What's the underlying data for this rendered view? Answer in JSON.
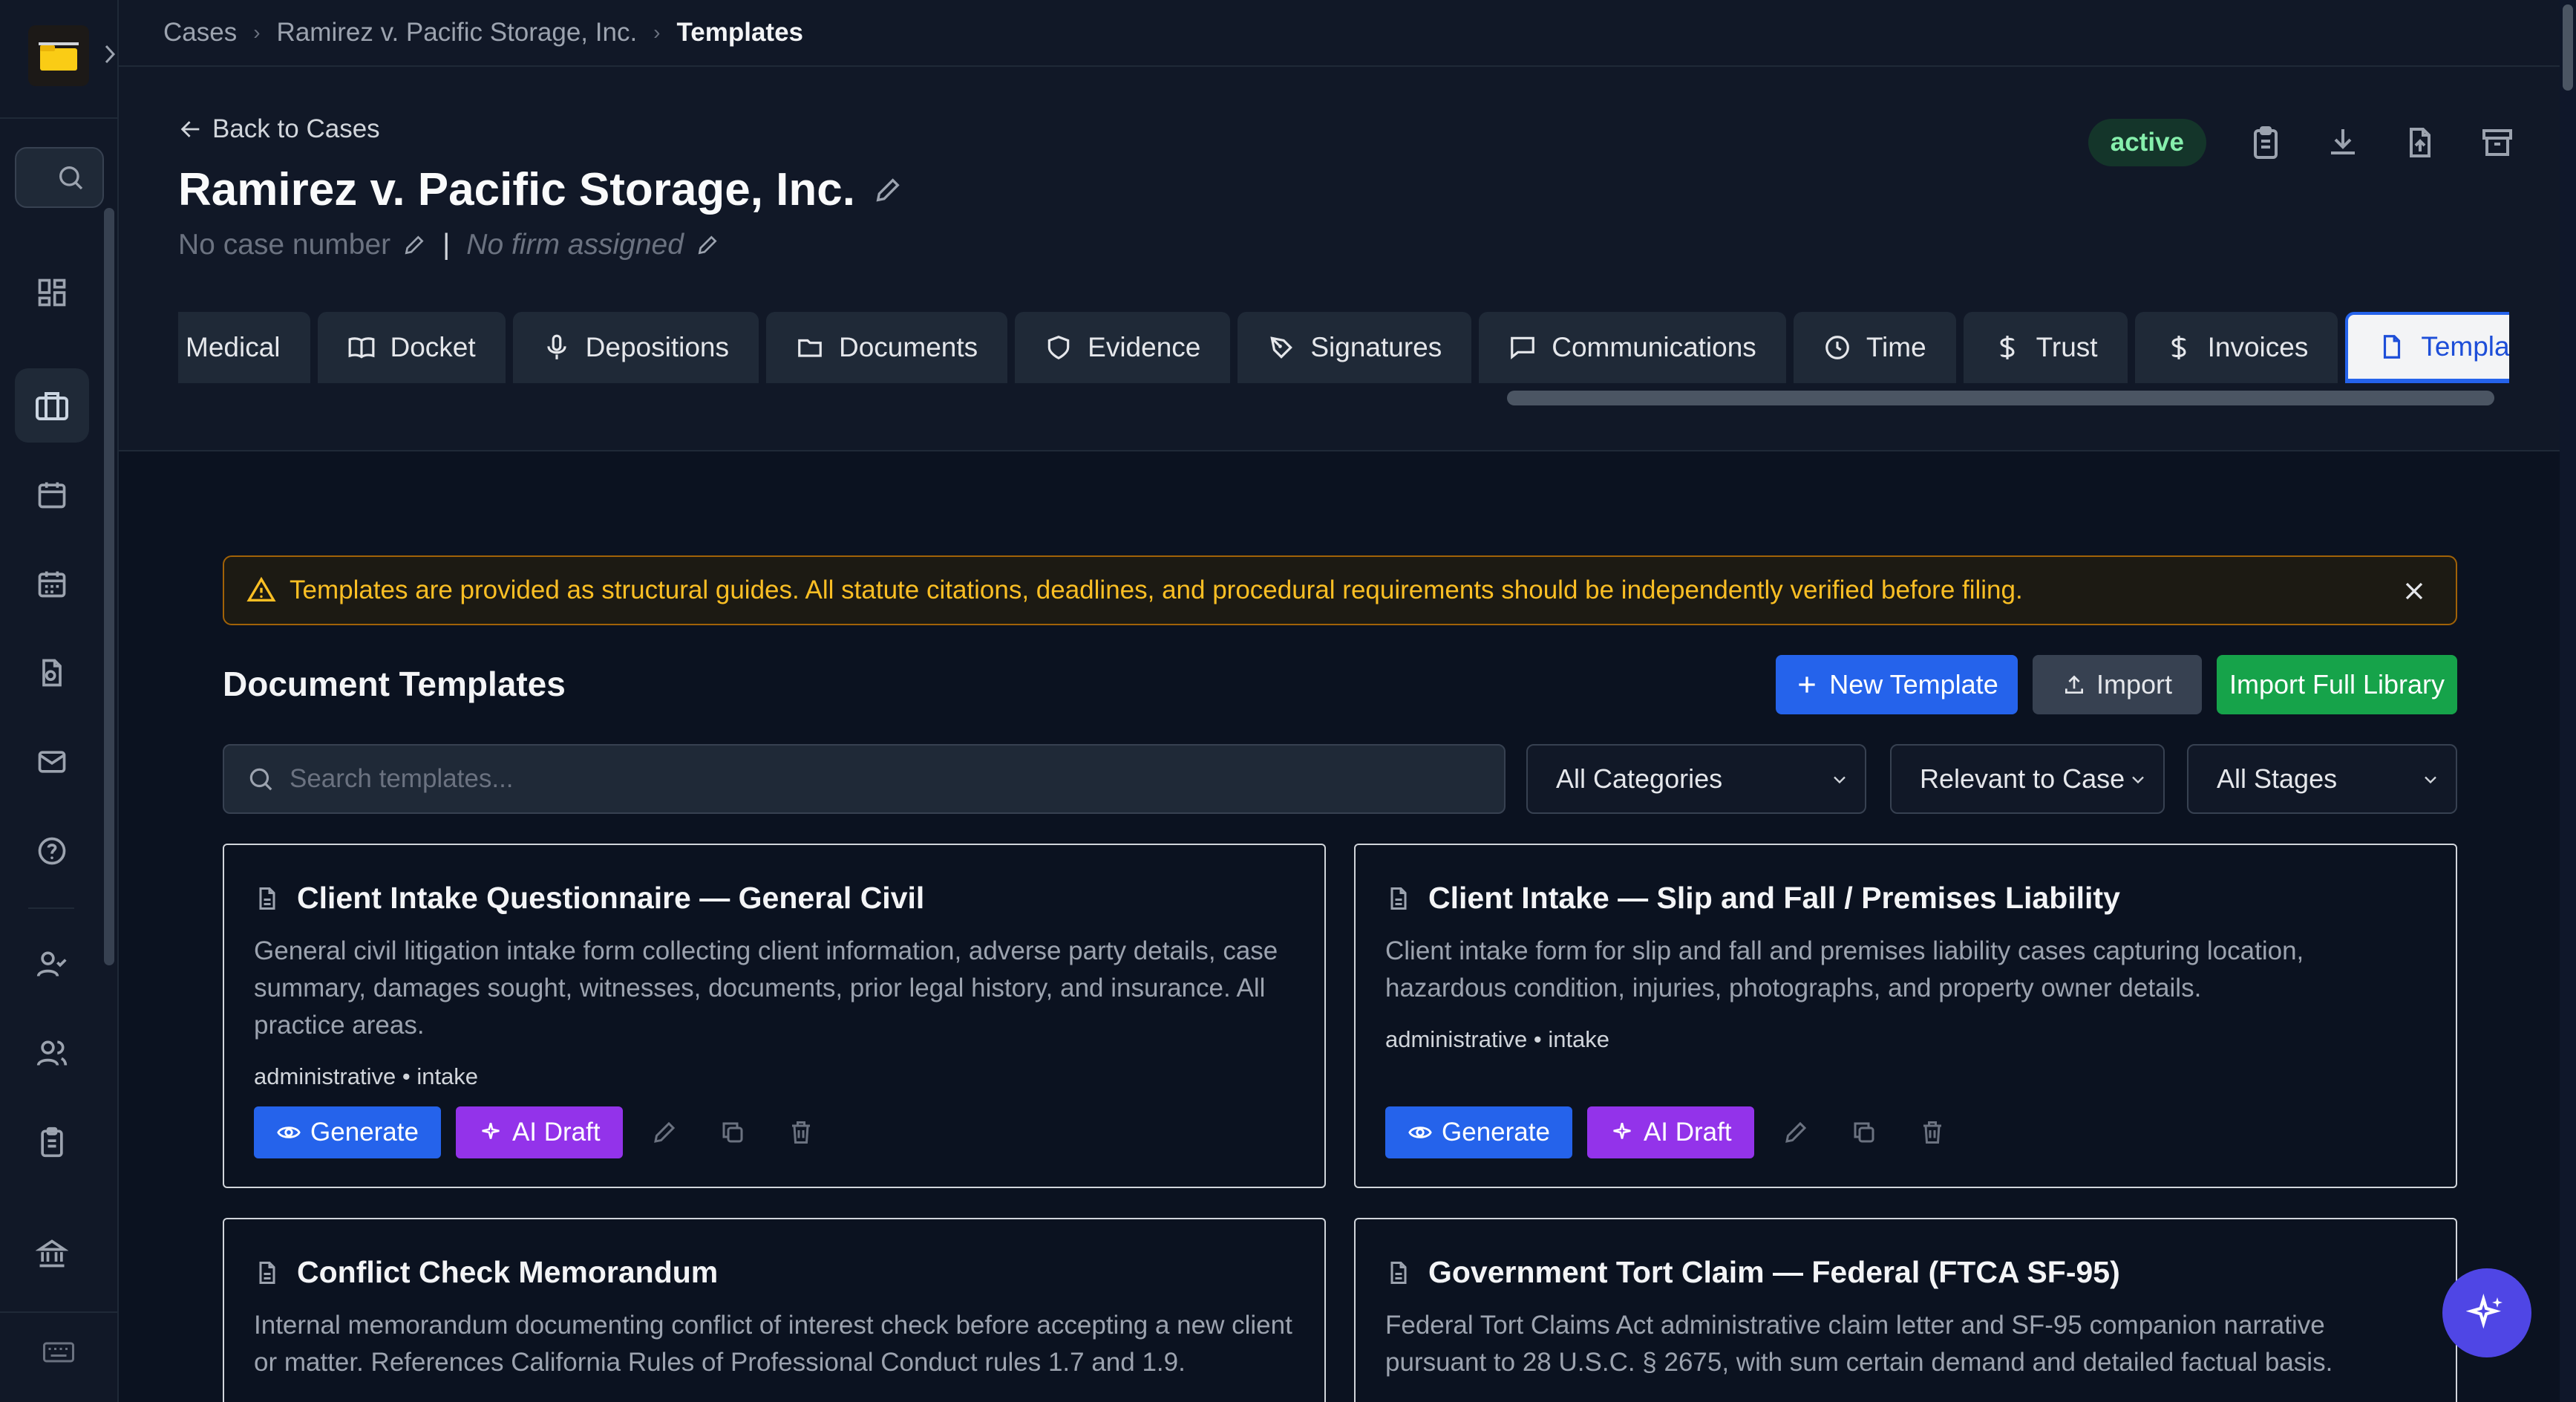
{
  "breadcrumb": {
    "items": [
      "Cases",
      "Ramirez v. Pacific Storage, Inc."
    ],
    "current": "Templates"
  },
  "header": {
    "back_label": "Back to Cases",
    "case_title": "Ramirez v. Pacific Storage, Inc.",
    "case_number": "No case number",
    "separator": "|",
    "firm": "No firm assigned",
    "status": "active"
  },
  "tabs": [
    {
      "label": "Medical",
      "icon": "medical-icon"
    },
    {
      "label": "Docket",
      "icon": "book-icon"
    },
    {
      "label": "Depositions",
      "icon": "microphone-icon"
    },
    {
      "label": "Documents",
      "icon": "folder-icon"
    },
    {
      "label": "Evidence",
      "icon": "shield-icon"
    },
    {
      "label": "Signatures",
      "icon": "pen-icon"
    },
    {
      "label": "Communications",
      "icon": "message-icon"
    },
    {
      "label": "Time",
      "icon": "clock-icon"
    },
    {
      "label": "Trust",
      "icon": "dollar-icon"
    },
    {
      "label": "Invoices",
      "icon": "dollar-icon"
    },
    {
      "label": "Templates",
      "icon": "file-icon",
      "active": true
    }
  ],
  "notice": {
    "text": "Templates are provided as structural guides. All statute citations, deadlines, and procedural requirements should be independently verified before filing."
  },
  "section": {
    "title": "Document Templates",
    "new_template": "New Template",
    "import": "Import",
    "import_library": "Import Full Library"
  },
  "filters": {
    "search_placeholder": "Search templates...",
    "category": "All Categories",
    "relevance": "Relevant to Case",
    "stage": "All Stages"
  },
  "cards": [
    {
      "title": "Client Intake Questionnaire — General Civil",
      "description": "General civil litigation intake form collecting client information, adverse party details, case summary, damages sought, witnesses, documents, prior legal history, and insurance. All practice areas.",
      "tags": "administrative • intake"
    },
    {
      "title": "Client Intake — Slip and Fall / Premises Liability",
      "description": "Client intake form for slip and fall and premises liability cases capturing location, hazardous condition, injuries, photographs, and property owner details.",
      "tags": "administrative • intake"
    },
    {
      "title": "Conflict Check Memorandum",
      "description": "Internal memorandum documenting conflict of interest check before accepting a new client or matter. References California Rules of Professional Conduct rules 1.7 and 1.9."
    },
    {
      "title": "Government Tort Claim — Federal (FTCA SF-95)",
      "description": "Federal Tort Claims Act administrative claim letter and SF-95 companion narrative pursuant to 28 U.S.C. § 2675, with sum certain demand and detailed factual basis."
    }
  ],
  "card_actions": {
    "generate": "Generate",
    "ai_draft": "AI Draft"
  },
  "colors": {
    "accent_blue": "#2563eb",
    "ai_purple": "#9333ea",
    "library_green": "#16a34a",
    "warning_amber": "#fbbf24",
    "status_green": "#86efac"
  }
}
